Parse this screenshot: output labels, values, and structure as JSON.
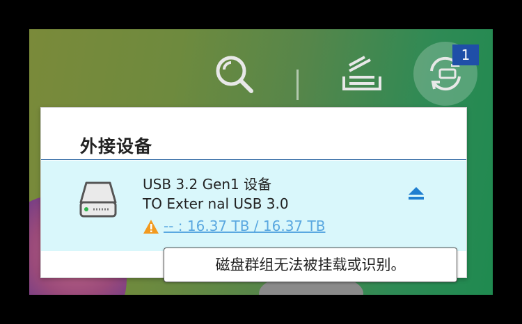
{
  "toolbar": {
    "search_icon": "search-icon",
    "tasks_icon": "background-tasks-icon",
    "external_device_icon": "external-device-icon",
    "external_device_badge": "1"
  },
  "panel": {
    "title": "外接设备",
    "device": {
      "icon": "drive-icon",
      "name": "USB 3.2 Gen1 设备",
      "model": "TO Exter nal USB 3.0",
      "status_icon": "warning-icon",
      "capacity": "-- : 16.37 TB / 16.37 TB",
      "eject_icon": "eject-icon"
    }
  },
  "tooltip": {
    "text": "磁盘群组无法被挂载或识别。"
  },
  "colors": {
    "row_highlight": "#d9f7fb",
    "badge": "#1f4fa8",
    "link": "#5aa8e0",
    "warning": "#f29a1f",
    "eject": "#1f7fd0"
  }
}
